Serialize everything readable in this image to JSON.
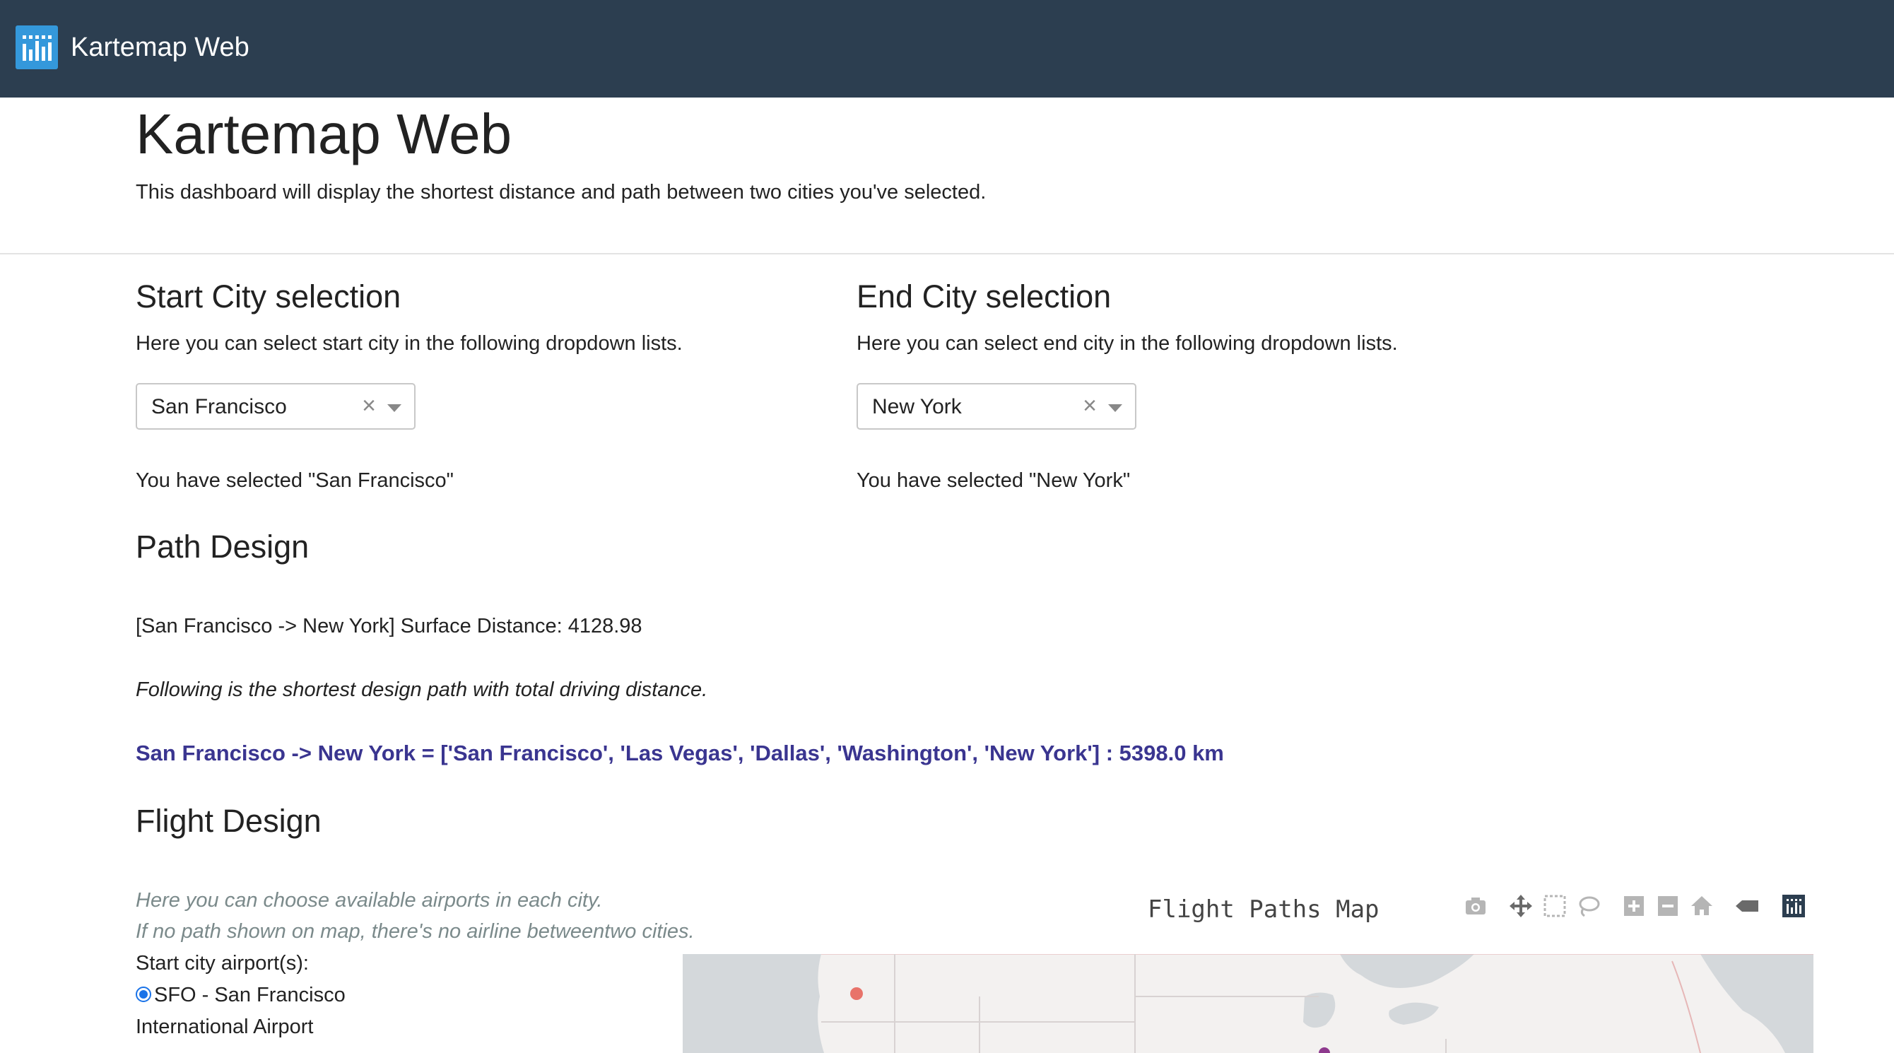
{
  "navbar": {
    "brand": "Kartemap Web",
    "logo_icon": "bar-chart-logo-icon"
  },
  "header": {
    "title": "Kartemap Web",
    "lead": "This dashboard will display the shortest distance and path between two cities you've selected."
  },
  "start": {
    "heading": "Start City selection",
    "description": "Here you can select start city in the following dropdown lists.",
    "selected_value": "San Francisco",
    "clear_symbol": "×",
    "selected_text": "You have selected \"San Francisco\""
  },
  "end": {
    "heading": "End City selection",
    "description": "Here you can select end city in the following dropdown lists.",
    "selected_value": "New York",
    "clear_symbol": "×",
    "selected_text": "You have selected \"New York\""
  },
  "path": {
    "heading": "Path Design",
    "surface_distance": "[San Francisco -> New York] Surface Distance: 4128.98",
    "note": "Following is the shortest design path with total driving distance.",
    "result": "San Francisco -> New York = ['San Francisco', 'Las Vegas', 'Dallas', 'Washington', 'New York'] : 5398.0 km"
  },
  "flight": {
    "heading": "Flight Design",
    "hint1": "Here you can choose available airports in each city.",
    "hint2": "If no path shown on map, there's no airline betweentwo cities.",
    "start_airports_label": "Start city airport(s):",
    "airport_option_line1": "SFO - San Francisco",
    "airport_option_line2": "International Airport"
  },
  "map": {
    "title": "Flight Paths Map",
    "modebar": [
      "camera-icon",
      "pan-icon",
      "box-select-icon",
      "lasso-icon",
      "zoom-in-icon",
      "zoom-out-icon",
      "reset-home-icon",
      "hover-label-icon",
      "plotly-logo-icon"
    ],
    "colors": {
      "land": "#f3f1f0",
      "water": "#d4d8db",
      "point_sf": "#e8736a",
      "point_other": "#8e3a8e"
    }
  }
}
